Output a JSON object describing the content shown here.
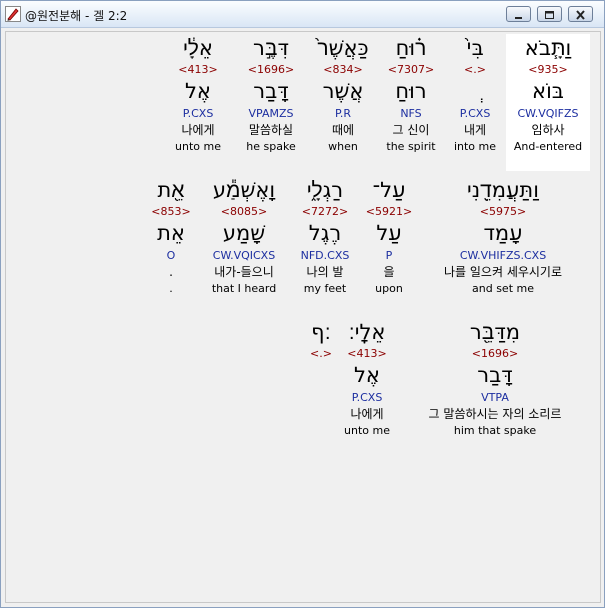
{
  "window": {
    "title": "@원전분해 - 겔 2:2"
  },
  "colors": {
    "strongs": "#8b0000",
    "parsing": "#1c2ea0",
    "highlight": "#ffffff"
  },
  "icons": {
    "app": "pen-icon",
    "minimize": "minimize-icon",
    "maximize": "maximize-icon",
    "close": "close-icon"
  },
  "rows": [
    {
      "words": [
        {
          "heb": "אֵלָ֔י",
          "num": "<413>",
          "root": "אֶל",
          "parse": "P.CXS",
          "kor": "나에게",
          "eng": "unto me"
        },
        {
          "heb": "דִּבֶּ֣ר",
          "num": "<1696>",
          "root": "דָּבַר",
          "parse": "VPAMZS",
          "kor": "말씀하실",
          "eng": "he spake"
        },
        {
          "heb": "כַּאֲשֶׁר֙",
          "num": "<834>",
          "root": "אֲשֶׁר",
          "parse": "P.R",
          "kor": "때에",
          "eng": "when"
        },
        {
          "heb": "ר֗וּחַ",
          "num": "<7307>",
          "root": "רוּחַ",
          "parse": "NFS",
          "kor": "그 신이",
          "eng": "the spirit"
        },
        {
          "heb": "בִּי֙",
          "num": "<.>",
          "root": "ְ",
          "parse": "P.CXS",
          "kor": "내게",
          "eng": "into me"
        },
        {
          "heb": "וַתָּ֧בֹא",
          "num": "<935>",
          "root": "בּוֹא",
          "parse": "CW.VQIFZS",
          "kor": "임하사",
          "eng": "And-entered"
        }
      ]
    },
    {
      "words": [
        {
          "heb": "אֵ֖ת",
          "num": "<853>",
          "root": "אֵת",
          "parse": "O",
          "kor": ".",
          "eng": "."
        },
        {
          "heb": "וָאֶשְׁמַ֕ע",
          "num": "<8085>",
          "root": "שָׁמַע",
          "parse": "CW.VQICXS",
          "kor": "내가-들으니",
          "eng": "that I heard"
        },
        {
          "heb": "רַגְלָ֑י",
          "num": "<7272>",
          "root": "רֶגֶל",
          "parse": "NFD.CXS",
          "kor": "나의 발",
          "eng": "my feet"
        },
        {
          "heb": "עַל־",
          "num": "<5921>",
          "root": "עַל",
          "parse": "P",
          "kor": "을",
          "eng": "upon"
        },
        {
          "heb": "וַתַּעֲמִדֵ֖נִי",
          "num": "<5975>",
          "root": "עָמַד",
          "parse": "CW.VHIFZS.CXS",
          "kor": "나를 일으켜 세우시기로",
          "eng": "and set me"
        }
      ]
    },
    {
      "words": [
        {
          "heb": "׃ף",
          "num": "<.>",
          "root": "",
          "parse": "",
          "kor": "",
          "eng": ""
        },
        {
          "heb": "אֵלָֽי׃",
          "num": "<413>",
          "root": "אֶל",
          "parse": "P.CXS",
          "kor": "나에게",
          "eng": "unto me"
        },
        {
          "heb": "מִדַּבֵּ֖ר",
          "num": "<1696>",
          "root": "דָּבַר",
          "parse": "VTPA",
          "kor": "그 말씀하시는 자의 소리르",
          "eng": "him that spake"
        }
      ]
    }
  ]
}
